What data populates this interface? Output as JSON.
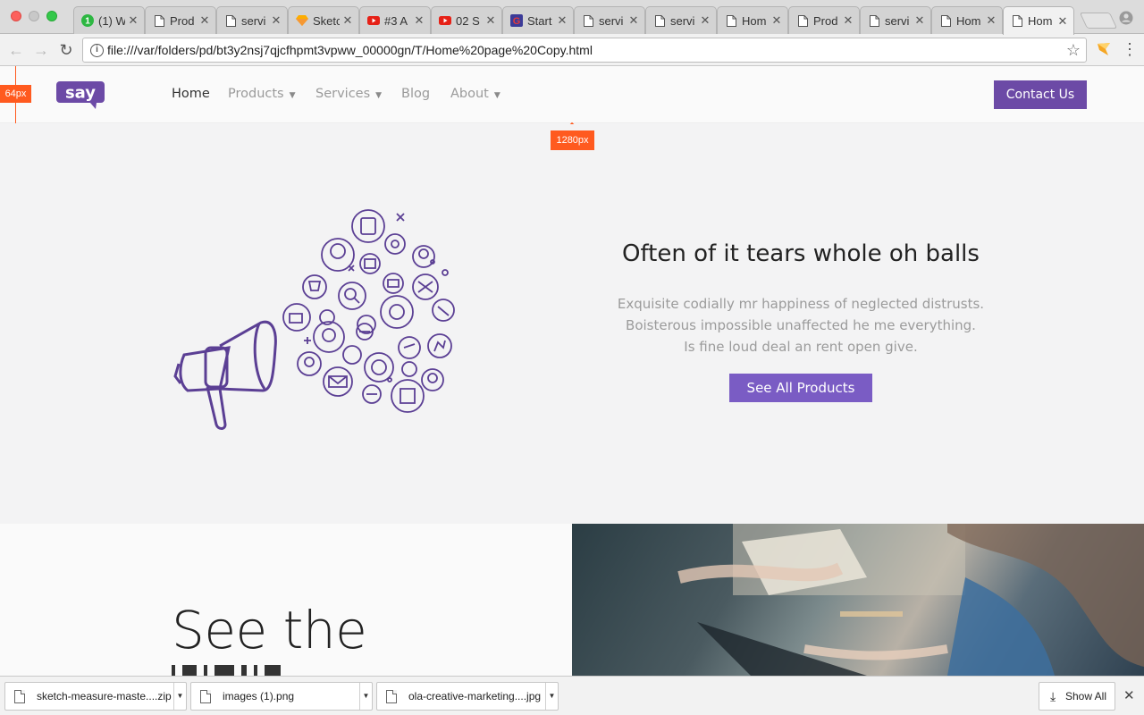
{
  "browser": {
    "tabs": [
      {
        "title": "(1) W",
        "favicon": "green-badge-icon",
        "badge": "1"
      },
      {
        "title": "Prod",
        "favicon": "page-icon"
      },
      {
        "title": "servi",
        "favicon": "page-icon"
      },
      {
        "title": "Sketc",
        "favicon": "sketch-diamond-icon"
      },
      {
        "title": "#3 A",
        "favicon": "youtube-icon"
      },
      {
        "title": "02 S",
        "favicon": "youtube-icon"
      },
      {
        "title": "Start",
        "favicon": "g-logo-icon"
      },
      {
        "title": "servi",
        "favicon": "page-icon"
      },
      {
        "title": "servi",
        "favicon": "page-icon"
      },
      {
        "title": "Hom",
        "favicon": "page-icon"
      },
      {
        "title": "Prod",
        "favicon": "page-icon"
      },
      {
        "title": "servi",
        "favicon": "page-icon"
      },
      {
        "title": "Hom",
        "favicon": "page-icon"
      },
      {
        "title": "Hom",
        "favicon": "page-icon",
        "active": true
      }
    ],
    "url": "file:///var/folders/pd/bt3y2nsj7qjcfhpmt3vpww_00000gn/T/Home%20page%20Copy.html"
  },
  "site": {
    "logo_text": "say",
    "brand_color": "#6c4aa6",
    "nav": {
      "home": "Home",
      "products": "Products",
      "services": "Services",
      "blog": "Blog",
      "about": "About",
      "caret": "▼"
    },
    "contact_label": "Contact Us"
  },
  "measure": {
    "height_label": "64px",
    "width_label": "1280px",
    "color": "#ff5a1f"
  },
  "hero": {
    "title": "Often of it tears whole oh balls",
    "lines": [
      "Exquisite codially mr happiness of neglected distrusts.",
      "Boisterous impossible unaffected he me everything.",
      "Is fine loud deal an rent open give."
    ],
    "button_label": "See All Products",
    "button_color": "#7a5cc4"
  },
  "section2": {
    "title": "See the"
  },
  "downloads": {
    "items": [
      {
        "name": "sketch-measure-maste....zip"
      },
      {
        "name": "images (1).png"
      },
      {
        "name": "ola-creative-marketing....jpg"
      }
    ],
    "show_all_label": "Show All"
  }
}
